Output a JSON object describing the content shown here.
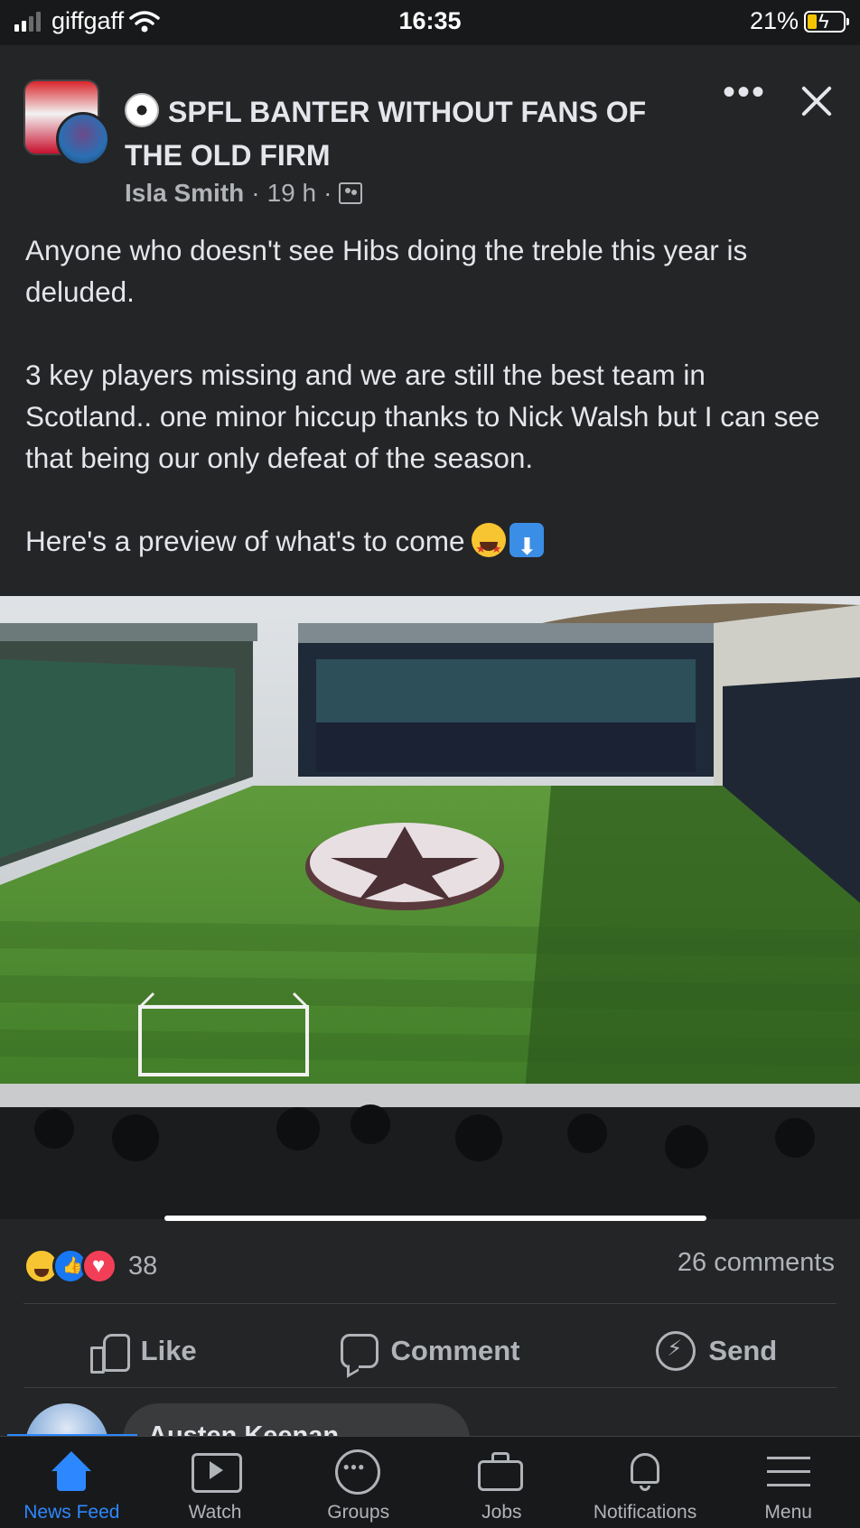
{
  "status_bar": {
    "carrier": "giffgaff",
    "time": "16:35",
    "battery": "21%"
  },
  "post": {
    "group_name": "SPFL BANTER WITHOUT FANS OF THE OLD FIRM",
    "author": "Isla Smith",
    "time_ago": "19 h",
    "separator": "·",
    "text": {
      "p1": "Anyone who doesn't see Hibs doing the treble this year is deluded.",
      "p2": "3 key players missing and we are still the best team in Scotland.. one minor hiccup thanks to Nick Walsh but I can see that being our only defeat of the season.",
      "p3": "Here's a preview of what's to come"
    },
    "image_icons": [
      "star-struck-emoji",
      "down-arrow-emoji"
    ],
    "reaction_count": "38",
    "reaction_types": [
      "haha",
      "like",
      "love"
    ],
    "comment_count": "26 comments"
  },
  "actions": {
    "like": "Like",
    "comment": "Comment",
    "send": "Send"
  },
  "comment_preview": {
    "name": "Austen Keenan"
  },
  "tab_bar": [
    {
      "label": "News Feed",
      "icon": "home-icon",
      "active": true
    },
    {
      "label": "Watch",
      "icon": "video-icon",
      "active": false
    },
    {
      "label": "Groups",
      "icon": "groups-icon",
      "active": false
    },
    {
      "label": "Jobs",
      "icon": "briefcase-icon",
      "active": false
    },
    {
      "label": "Notifications",
      "icon": "bell-icon",
      "active": false
    },
    {
      "label": "Menu",
      "icon": "hamburger-icon",
      "active": false
    }
  ],
  "colors": {
    "background": "#242526",
    "accent": "#2d88ff",
    "text_primary": "#e4e6eb",
    "text_secondary": "#b0b3b8"
  }
}
